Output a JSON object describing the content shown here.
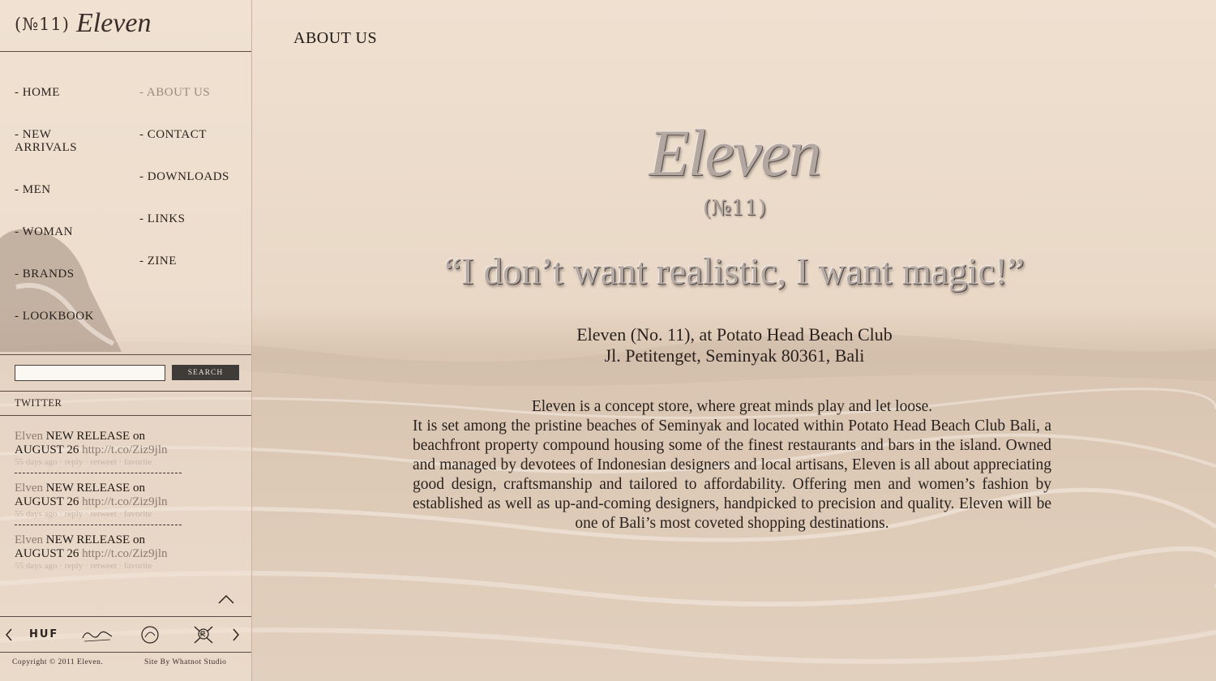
{
  "brand": {
    "logo_number": "(№11)",
    "logo_name": "Eleven"
  },
  "nav": {
    "left": [
      {
        "label": "- HOME"
      },
      {
        "label": "- NEW ARRIVALS"
      },
      {
        "label": "- MEN"
      },
      {
        "label": "- WOMAN"
      },
      {
        "label": "- BRANDS"
      },
      {
        "label": "- LOOKBOOK"
      }
    ],
    "right": [
      {
        "label": "- ABOUT US",
        "active": true
      },
      {
        "label": "- CONTACT"
      },
      {
        "label": "- DOWNLOADS"
      },
      {
        "label": "- LINKS"
      },
      {
        "label": "- ZINE"
      }
    ]
  },
  "search": {
    "placeholder": "",
    "value": "",
    "button_label": "SEARCH"
  },
  "twitter": {
    "title": "TWITTER",
    "tweets": [
      {
        "user": "Elven",
        "text": "NEW RELEASE on AUGUST 26",
        "link": "http://t.co/Ziz9jln",
        "meta": "55 days ago · reply · retweet · favorite"
      },
      {
        "user": "Elven",
        "text": "NEW RELEASE on AUGUST 26",
        "link": "http://t.co/Ziz9jln",
        "meta": "55 days ago · reply · retweet · favorite"
      },
      {
        "user": "Elven",
        "text": "NEW RELEASE on AUGUST 26",
        "link": "http://t.co/Ziz9jln",
        "meta": "55 days ago · reply · retweet · favorite"
      }
    ]
  },
  "brands_carousel": {
    "items": [
      "HUF",
      "",
      "",
      ""
    ],
    "icons": [
      "huf-logo",
      "script-brand-logo",
      "circular-brand-logo",
      "crest-brand-logo"
    ]
  },
  "footer": {
    "copyright": "Copyright © 2011 Eleven.",
    "credit": "Site By Whatnot Studio"
  },
  "main": {
    "page_title": "ABOUT US",
    "hero_name": "Eleven",
    "hero_number": "(№11)",
    "quote": "“I don’t want realistic, I want magic!”",
    "address_line1": "Eleven (No. 11), at Potato Head Beach Club",
    "address_line2": "Jl. Petitenget, Seminyak 80361, Bali",
    "description_lead": "Eleven is a concept store, where great minds play and let loose.",
    "description_body": "It is set among the pristine beaches of Seminyak and located within Potato Head Beach Club Bali, a beachfront property compound housing some of the finest restaurants and bars in the island. Owned and managed by devotees of Indonesian designers and local artisans, Eleven is all about appreciating good design, craftsmanship and tailored to affordability. Offering men and women’s fashion by established as well as up-and-coming designers, handpicked to precision and quality. Eleven will be one of Bali’s most coveted shopping destinations."
  },
  "colors": {
    "background": "#e8d6c4",
    "text": "#2a221e",
    "active_nav": "#9a8a80",
    "button": "#3f3b39"
  }
}
